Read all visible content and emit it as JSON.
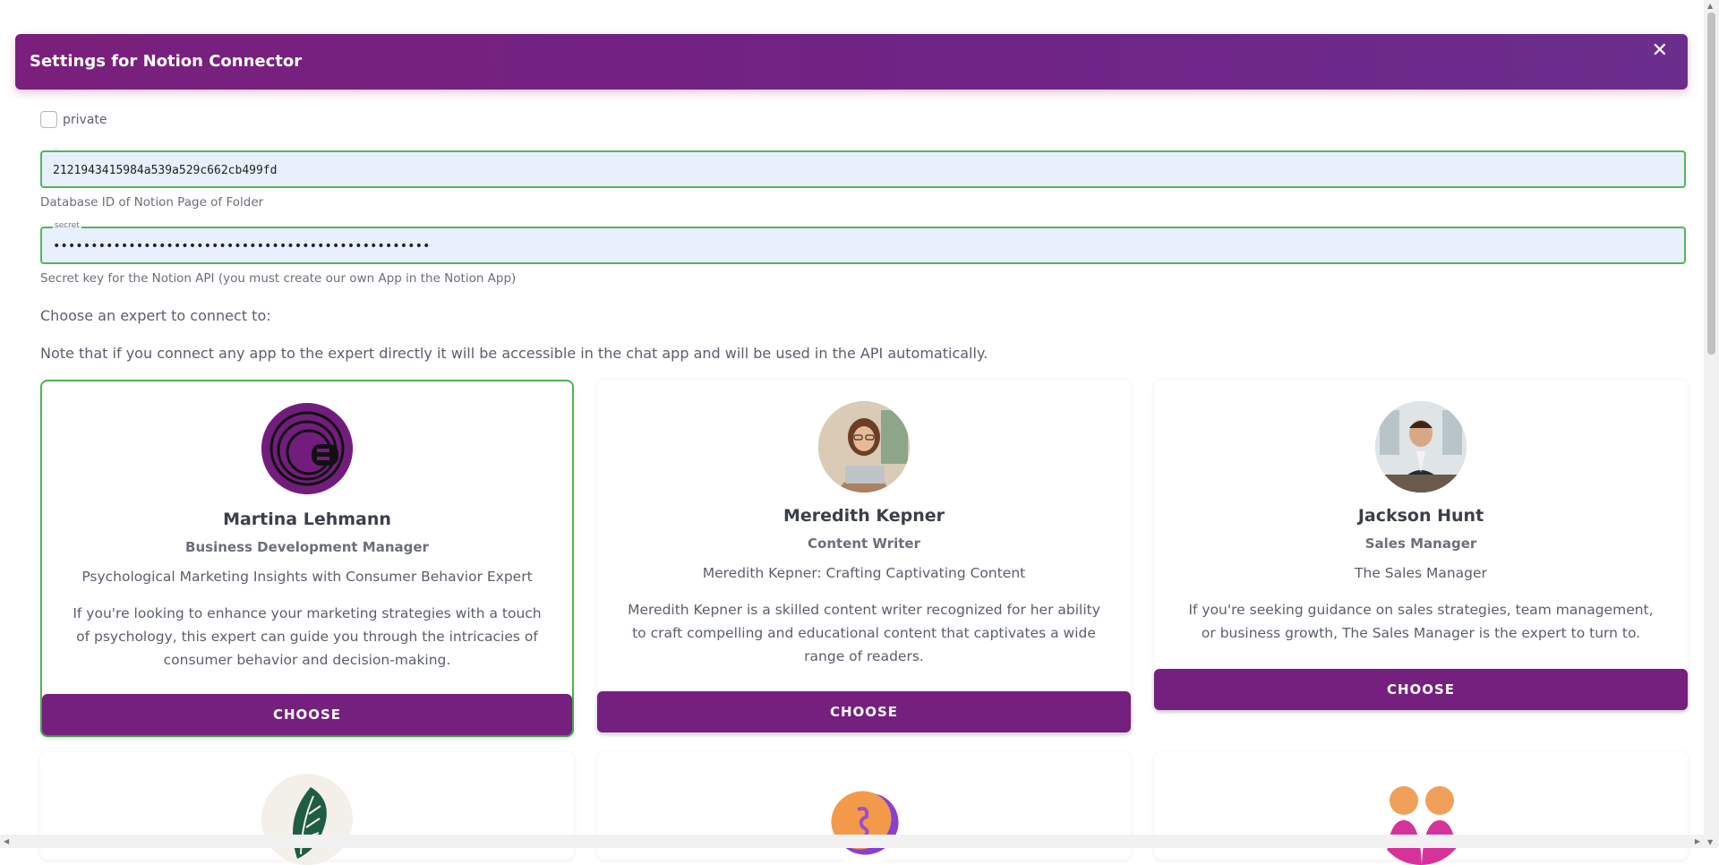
{
  "dialog": {
    "title": "Settings for Notion Connector",
    "close_symbol": "✕"
  },
  "form": {
    "private_label": "private",
    "database_id": {
      "top_label": "",
      "value": "2121943415984a539a529c662cb499fd",
      "hint": "Database ID of Notion Page of Folder"
    },
    "secret": {
      "top_label": "secret",
      "value": "••••••••••••••••••••••••••••••••••••••••••••••••••",
      "hint": "Secret key for the Notion API (you must create our own App in the Notion App)"
    },
    "choose_prompt": "Choose an expert to connect to:",
    "note": "Note that if you connect any app to the expert directly it will be accessible in the chat app and will be used in the API automatically."
  },
  "experts": [
    {
      "name": "Martina Lehmann",
      "role": "Business Development Manager",
      "tagline": "Psychological Marketing Insights with Consumer Behavior Expert",
      "description": "If you're looking to enhance your marketing strategies with a touch of psychology, this expert can guide you through the intricacies of consumer behavior and decision-making.",
      "button": "CHOOSE",
      "selected": true
    },
    {
      "name": "Meredith Kepner",
      "role": "Content Writer",
      "tagline": "Meredith Kepner: Crafting Captivating Content",
      "description": "Meredith Kepner is a skilled content writer recognized for her ability to craft compelling and educational content that captivates a wide range of readers.",
      "button": "CHOOSE",
      "selected": false
    },
    {
      "name": "Jackson Hunt",
      "role": "Sales Manager",
      "tagline": "The Sales Manager",
      "description": "If you're seeking guidance on sales strategies, team management, or business growth, The Sales Manager is the expert to turn to.",
      "button": "CHOOSE",
      "selected": false
    }
  ],
  "colors": {
    "accent": "#751f7e",
    "selected_border": "#4fb34f",
    "input_bg": "#e8f0fe"
  }
}
